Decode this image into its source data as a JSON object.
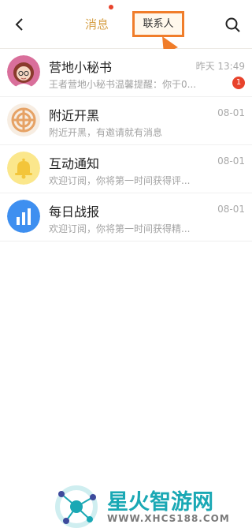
{
  "header": {
    "tabs": [
      {
        "label": "消息",
        "active": true
      },
      {
        "label": "联系人",
        "highlighted": true
      }
    ],
    "back_icon": "chevron-left-icon",
    "search_icon": "search-icon",
    "accent_color": "#d7a24a",
    "highlight_color": "#f07d2a"
  },
  "messages": [
    {
      "title": "营地小秘书",
      "subtitle": "王者营地小秘书温馨提醒：你于0...",
      "time": "昨天 13:49",
      "badge": "1",
      "icon": "girl-avatar-icon"
    },
    {
      "title": "附近开黑",
      "subtitle": "附近开黑，有邀请就有消息",
      "time": "08-01",
      "icon": "radar-icon"
    },
    {
      "title": "互动通知",
      "subtitle": "欢迎订阅，你将第一时间获得评...",
      "time": "08-01",
      "icon": "bell-icon"
    },
    {
      "title": "每日战报",
      "subtitle": "欢迎订阅，你将第一时间获得精...",
      "time": "08-01",
      "icon": "bar-chart-icon"
    }
  ],
  "watermark": {
    "title": "星火智游网",
    "url": "WWW.XHCS188.COM"
  }
}
